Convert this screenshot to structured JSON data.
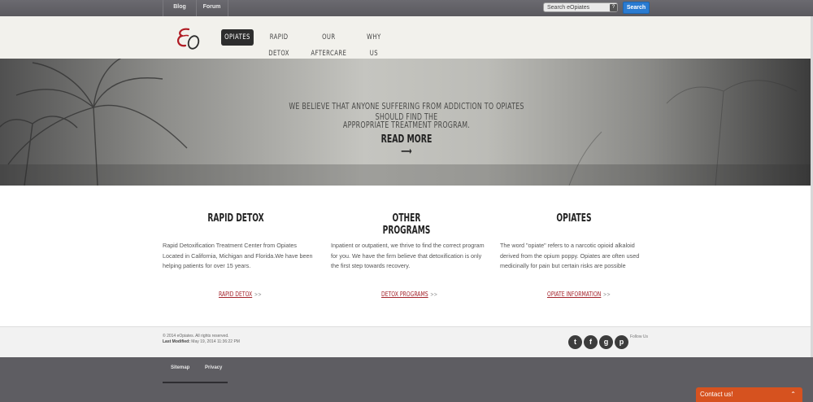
{
  "topbar": {
    "blog": "Blog",
    "forum": "Forum",
    "search_value": "Search eOpiates",
    "search_help": "?",
    "search_button": "Search"
  },
  "nav": {
    "active": "OPIATES",
    "rapid": "RAPID DETOX",
    "aftercare": "OUR AFTERCARE",
    "why": "WHY US"
  },
  "hero": {
    "line1": "WE BELIEVE THAT ANYONE SUFFERING FROM ADDICTION TO OPIATES SHOULD FIND THE",
    "line2": "APPROPRIATE TREATMENT PROGRAM.",
    "cta": "READ MORE ⟶"
  },
  "columns": [
    {
      "title": "RAPID DETOX",
      "text": "Rapid Detoxification Treatment Center from Opiates Located in California, Michigan and Florida.We have been helping patients for over 15 years.",
      "link": "RAPID DETOX",
      "arrow": ">>"
    },
    {
      "title": "OTHER PROGRAMS",
      "text": "Inpatient or outpatient, we thrive to find the correct program for you. We have the firm believe that detoxification is only the first step towards recovery.",
      "link": "DETOX PROGRAMS",
      "arrow": ">>"
    },
    {
      "title": "OPIATES",
      "text": "The word \"opiate\" refers to a narcotic opioid alkaloid derived from the opium poppy. Opiates are often used medicinally for pain but certain risks are possible",
      "link": "OPIATE INFORMATION",
      "arrow": ">>"
    }
  ],
  "footer": {
    "copyright": "© 2014 eOpiates. All rights reserved.",
    "modified_label": "Last Modified:",
    "modified_value": "May 19, 2014 11:36:22 PM",
    "follow": "Follow Us"
  },
  "social": [
    "t",
    "f",
    "g",
    "p"
  ],
  "bottom": {
    "sitemap": "Sitemap",
    "privacy": "Privacy"
  },
  "contact": {
    "label": "Contact us!",
    "chevron": "⌃"
  },
  "colors": {
    "accent_link": "#a4232b",
    "search_button": "#2a7bd1",
    "contact": "#d6521f"
  }
}
